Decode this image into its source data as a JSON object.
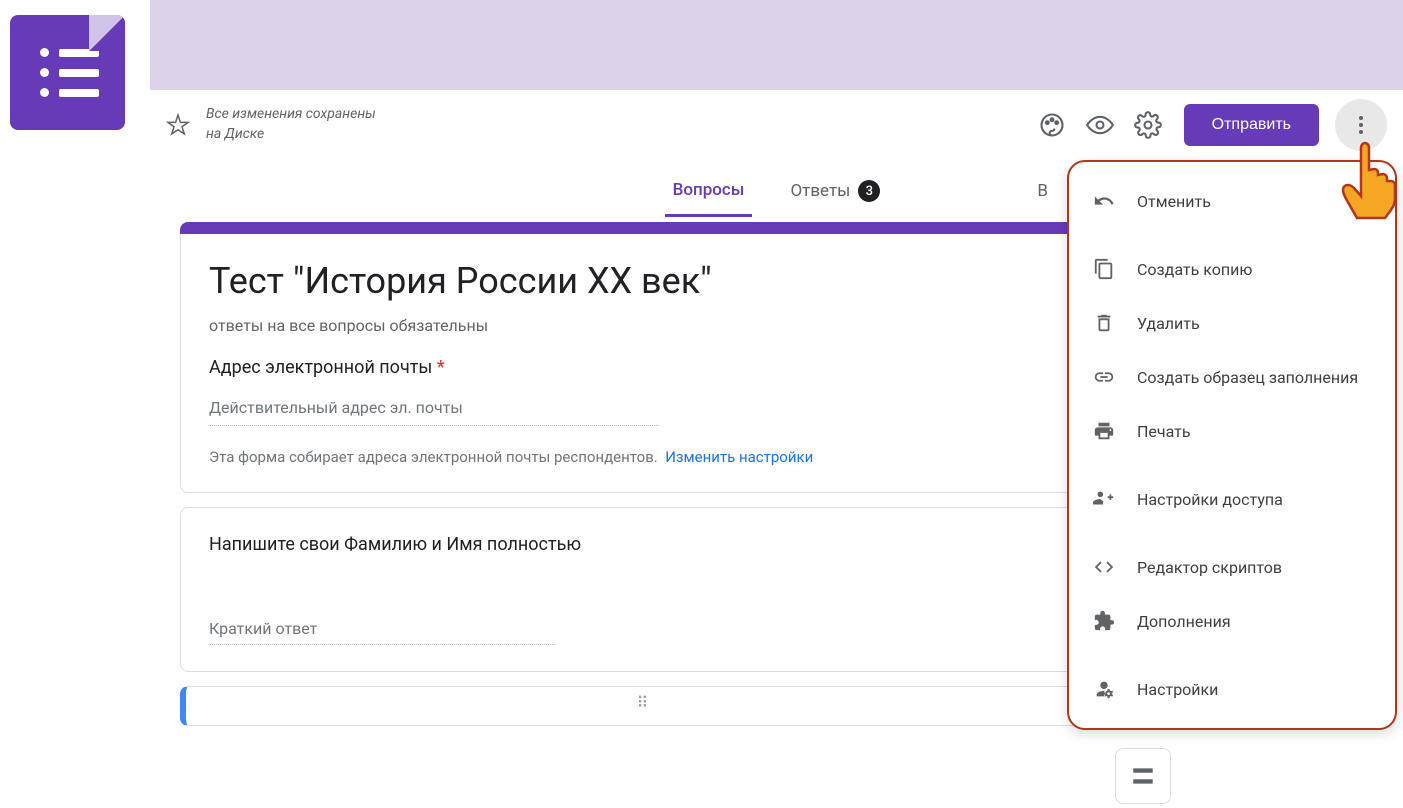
{
  "saveStatus": "Все изменения сохранены\nна Диске",
  "sendButton": "Отправить",
  "tabs": {
    "questions": "Вопросы",
    "answers": "Ответы",
    "answersCount": "3",
    "visibilityCut": "В"
  },
  "form": {
    "title": "Тест \"История России XX век\"",
    "description": "ответы на все вопросы обязательны",
    "emailLabel": "Адрес электронной почты",
    "emailPlaceholder": "Действительный адрес эл. почты",
    "collectNote": "Эта форма собирает адреса электронной почты респондентов.",
    "changeLink": "Изменить настройки"
  },
  "question1": {
    "title": "Напишите свои Фамилию и Имя полностью",
    "placeholder": "Краткий ответ"
  },
  "menu": {
    "undo": "Отменить",
    "copy": "Создать копию",
    "delete": "Удалить",
    "prefill": "Создать образец заполнения",
    "print": "Печать",
    "collaborators": "Настройки доступа",
    "scriptEditor": "Редактор скриптов",
    "addons": "Дополнения",
    "preferences": "Настройки"
  }
}
